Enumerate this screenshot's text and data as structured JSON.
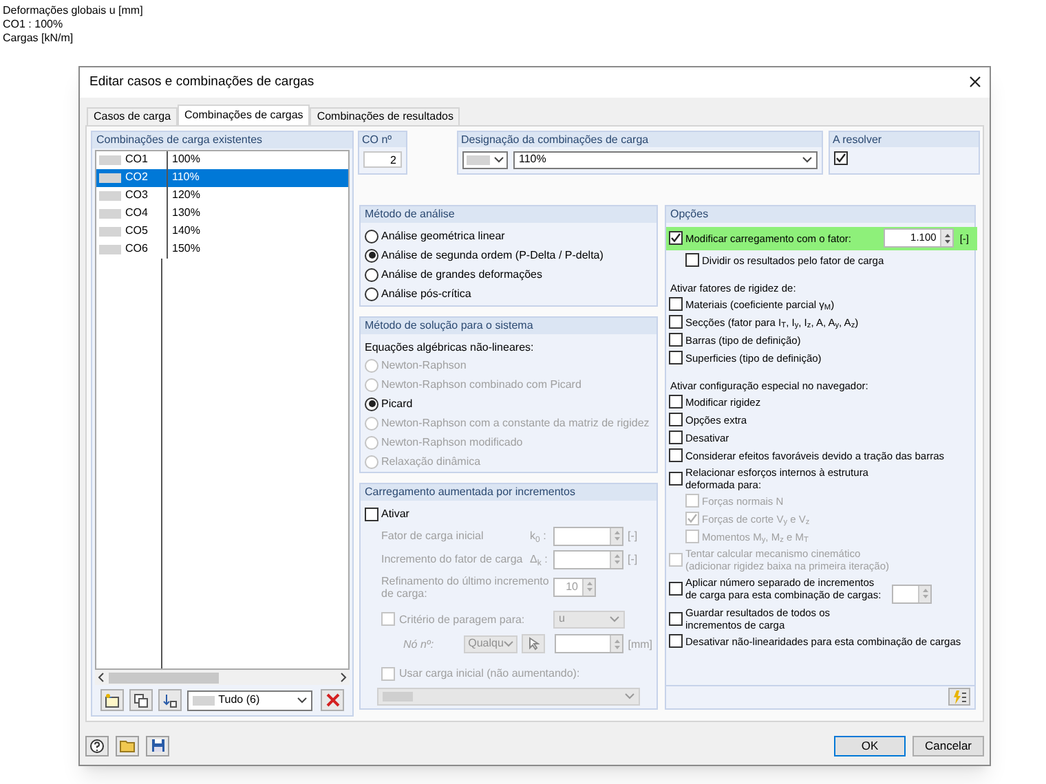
{
  "background_labels": [
    "Deformações globais u [mm]",
    "CO1 : 100%",
    "Cargas [kN/m]"
  ],
  "window": {
    "title": "Editar casos e combinações de cargas"
  },
  "tabs": [
    {
      "label": "Casos de carga",
      "selected": false
    },
    {
      "label": "Combinações de cargas",
      "selected": true
    },
    {
      "label": "Combinações de resultados",
      "selected": false
    }
  ],
  "combinations": {
    "title": "Combinações de carga existentes",
    "rows": [
      {
        "id": "CO1",
        "description": "100%",
        "selected": false
      },
      {
        "id": "CO2",
        "description": "110%",
        "selected": true
      },
      {
        "id": "CO3",
        "description": "120%",
        "selected": false
      },
      {
        "id": "CO4",
        "description": "130%",
        "selected": false
      },
      {
        "id": "CO5",
        "description": "140%",
        "selected": false
      },
      {
        "id": "CO6",
        "description": "150%",
        "selected": false
      }
    ],
    "filter": "Tudo (6)"
  },
  "co_number": {
    "label": "CO nº",
    "value": "2"
  },
  "designation": {
    "label": "Designação da combinações de carga",
    "value": "110%"
  },
  "to_solve": {
    "label": "A resolver",
    "checked": true
  },
  "analysis_method": {
    "title": "Método de análise",
    "options": [
      {
        "label": "Análise geométrica linear",
        "selected": false
      },
      {
        "label": "Análise de segunda ordem (P-Delta / P-delta)",
        "selected": true
      },
      {
        "label": "Análise de grandes deformações",
        "selected": false
      },
      {
        "label": "Análise pós-crítica",
        "selected": false
      }
    ]
  },
  "solution_method": {
    "title": "Método de solução para o sistema",
    "subtitle": "Equações algébricas não-lineares:",
    "options": [
      {
        "label": "Newton-Raphson",
        "selected": false,
        "disabled": true
      },
      {
        "label": "Newton-Raphson combinado com Picard",
        "selected": false,
        "disabled": true
      },
      {
        "label": "Picard",
        "selected": true,
        "disabled": false
      },
      {
        "label": "Newton-Raphson com a constante da matriz de rigidez",
        "selected": false,
        "disabled": true
      },
      {
        "label": "Newton-Raphson modificado",
        "selected": false,
        "disabled": true
      },
      {
        "label": "Relaxação dinâmica",
        "selected": false,
        "disabled": true
      }
    ]
  },
  "incremental": {
    "title": "Carregamento aumentada por incrementos",
    "activate": {
      "label": "Ativar",
      "checked": false
    },
    "fields": [
      {
        "label": "Fator de carga inicial",
        "symbol": "k$_{0}$ :",
        "unit": "[-]"
      },
      {
        "label": "Incremento do fator de carga",
        "symbol": "Δ$_{k}$ :",
        "unit": "[-]"
      }
    ],
    "refinement": {
      "label": "Refinamento do último incremento\nde carga:",
      "value": "10"
    },
    "stop_criterion": {
      "label": "Critério de paragem para:",
      "checked": false,
      "value": "u"
    },
    "node": {
      "label": "Nó nº:",
      "value": "Qualqu",
      "unit": "[mm]"
    },
    "initial_load": {
      "label": "Usar carga inicial (não aumentando):",
      "checked": false
    }
  },
  "options": {
    "title": "Opções",
    "items": [
      {
        "kind": "factor",
        "label": "Modificar carregamento com o fator:",
        "checked": true,
        "disabled": false,
        "highlighted": true,
        "value": "1.100",
        "unit": "[-]",
        "children": [
          {
            "kind": "checkbox",
            "label": "Dividir os resultados pelo fator de carga",
            "checked": false,
            "disabled": false
          }
        ]
      },
      {
        "kind": "heading",
        "label": "Ativar fatores de rigidez de:"
      },
      {
        "kind": "checkbox",
        "label": "Materiais (coeficiente parcial γ$_{M}$)",
        "checked": false,
        "disabled": false
      },
      {
        "kind": "checkbox",
        "label": "Secções (fator para I$_{T}$, I$_{y}$, I$_{z}$, A, A$_{y}$, A$_{z}$)",
        "checked": false,
        "disabled": false
      },
      {
        "kind": "checkbox",
        "label": "Barras (tipo de definição)",
        "checked": false,
        "disabled": false
      },
      {
        "kind": "checkbox",
        "label": "Superficies (tipo de definição)",
        "checked": false,
        "disabled": false
      },
      {
        "kind": "heading",
        "label": "Ativar configuração especial no navegador:"
      },
      {
        "kind": "checkbox",
        "label": "Modificar rigidez",
        "checked": false,
        "disabled": false
      },
      {
        "kind": "checkbox",
        "label": "Opções extra",
        "checked": false,
        "disabled": false
      },
      {
        "kind": "checkbox",
        "label": "Desativar",
        "checked": false,
        "disabled": false
      },
      {
        "kind": "checkbox",
        "label": "Considerar efeitos favoráveis devido a tração das barras",
        "checked": false,
        "disabled": false
      },
      {
        "kind": "checkbox",
        "label": "Relacionar esforços internos à estrutura\ndeformada para:",
        "checked": false,
        "disabled": false,
        "children": [
          {
            "kind": "checkbox",
            "label": "Forças normais N",
            "checked": false,
            "disabled": true
          },
          {
            "kind": "checkbox",
            "label": "Forças de corte V$_{y}$ e V$_{z}$",
            "checked": true,
            "disabled": true
          },
          {
            "kind": "checkbox",
            "label": "Momentos M$_{y}$, M$_{z}$ e M$_{T}$",
            "checked": false,
            "disabled": true
          }
        ]
      },
      {
        "kind": "checkbox",
        "label": "Tentar calcular mecanismo cinemático\n(adicionar rigidez baixa na primeira iteração)",
        "checked": false,
        "disabled": true
      },
      {
        "kind": "count",
        "label": "Aplicar número separado de incrementos\nde carga para esta combinação de cargas:",
        "checked": false,
        "disabled": false
      },
      {
        "kind": "checkbox",
        "label": "Guardar resultados de todos os\nincrementos de carga",
        "checked": false,
        "disabled": false
      },
      {
        "kind": "checkbox",
        "label": "Desativar não-linearidades para esta combinação de cargas",
        "checked": false,
        "disabled": false
      }
    ]
  },
  "buttons": [
    {
      "label": "OK",
      "default": true
    },
    {
      "label": "Cancelar",
      "default": false
    }
  ]
}
